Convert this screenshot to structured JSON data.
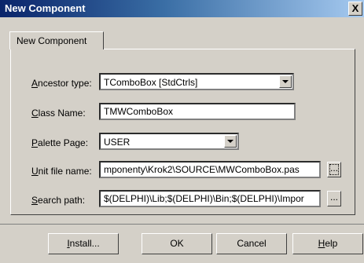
{
  "window": {
    "title": "New Component",
    "close_label": "X"
  },
  "tab": {
    "label": "New Component"
  },
  "form": {
    "ancestor_label": {
      "accel": "A",
      "rest": "ncestor type:"
    },
    "ancestor_value": "TComboBox  [StdCtrls]",
    "classname_label": {
      "accel": "C",
      "rest": "lass Name:"
    },
    "classname_value": "TMWComboBox",
    "palette_label": {
      "accel": "P",
      "rest": "alette Page:"
    },
    "palette_value": "USER",
    "unit_label": {
      "accel": "U",
      "rest": "nit file name:"
    },
    "unit_value": "mponenty\\Krok2\\SOURCE\\MWComboBox.pas",
    "unit_browse": "...",
    "search_label": {
      "accel": "S",
      "rest": "earch path:"
    },
    "search_value": "$(DELPHI)\\Lib;$(DELPHI)\\Bin;$(DELPHI)\\Impor",
    "search_browse": "..."
  },
  "buttons": {
    "install": {
      "accel": "I",
      "rest": "nstall..."
    },
    "ok": "OK",
    "cancel": "Cancel",
    "help": {
      "accel": "H",
      "rest": "elp"
    }
  }
}
